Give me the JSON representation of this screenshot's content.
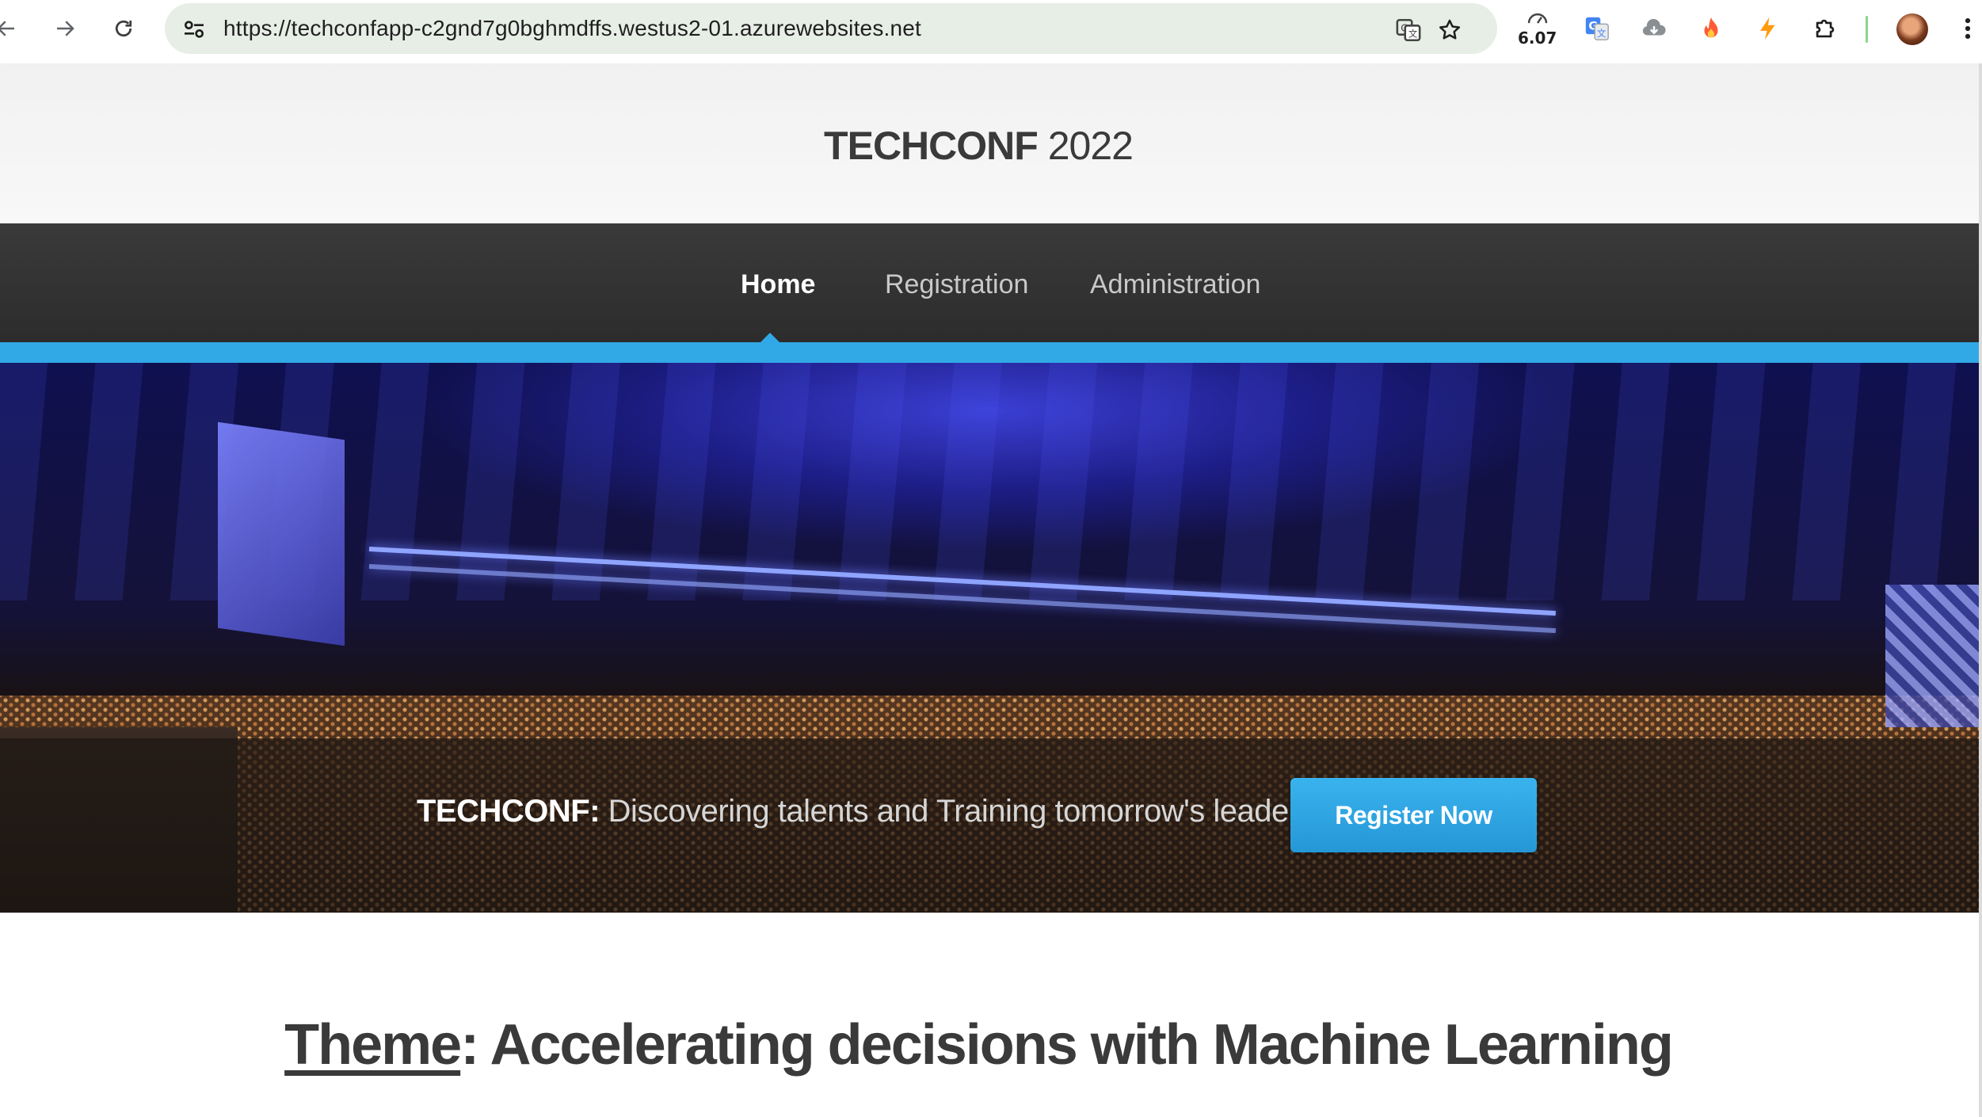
{
  "browser": {
    "url": "https://techconfapp-c2gnd7g0bghmdffs.westus2-01.azurewebsites.net",
    "extension_counter": "6.07",
    "icons": [
      "back-arrow-icon",
      "forward-arrow-icon",
      "reload-icon",
      "site-info-icon",
      "translate-icon",
      "bookmark-star-icon",
      "google-translate-icon",
      "cloud-download-icon",
      "flame-icon",
      "bolt-icon",
      "puzzle-extensions-icon",
      "avatar",
      "kebab-menu-icon"
    ]
  },
  "header": {
    "brand_bold": "TECHCONF",
    "brand_year": " 2022"
  },
  "nav": {
    "items": [
      {
        "label": "Home",
        "active": true
      },
      {
        "label": "Registration",
        "active": false
      },
      {
        "label": "Administration",
        "active": false
      }
    ],
    "accent_color": "#31a9e6"
  },
  "hero": {
    "tagline_bold": "TECHCONF:",
    "tagline_text": " Discovering talents and Training tomorrow's leaders",
    "register_button": "Register Now"
  },
  "theme": {
    "link_text": "Theme",
    "text": ": Accelerating decisions with Machine Learning"
  }
}
